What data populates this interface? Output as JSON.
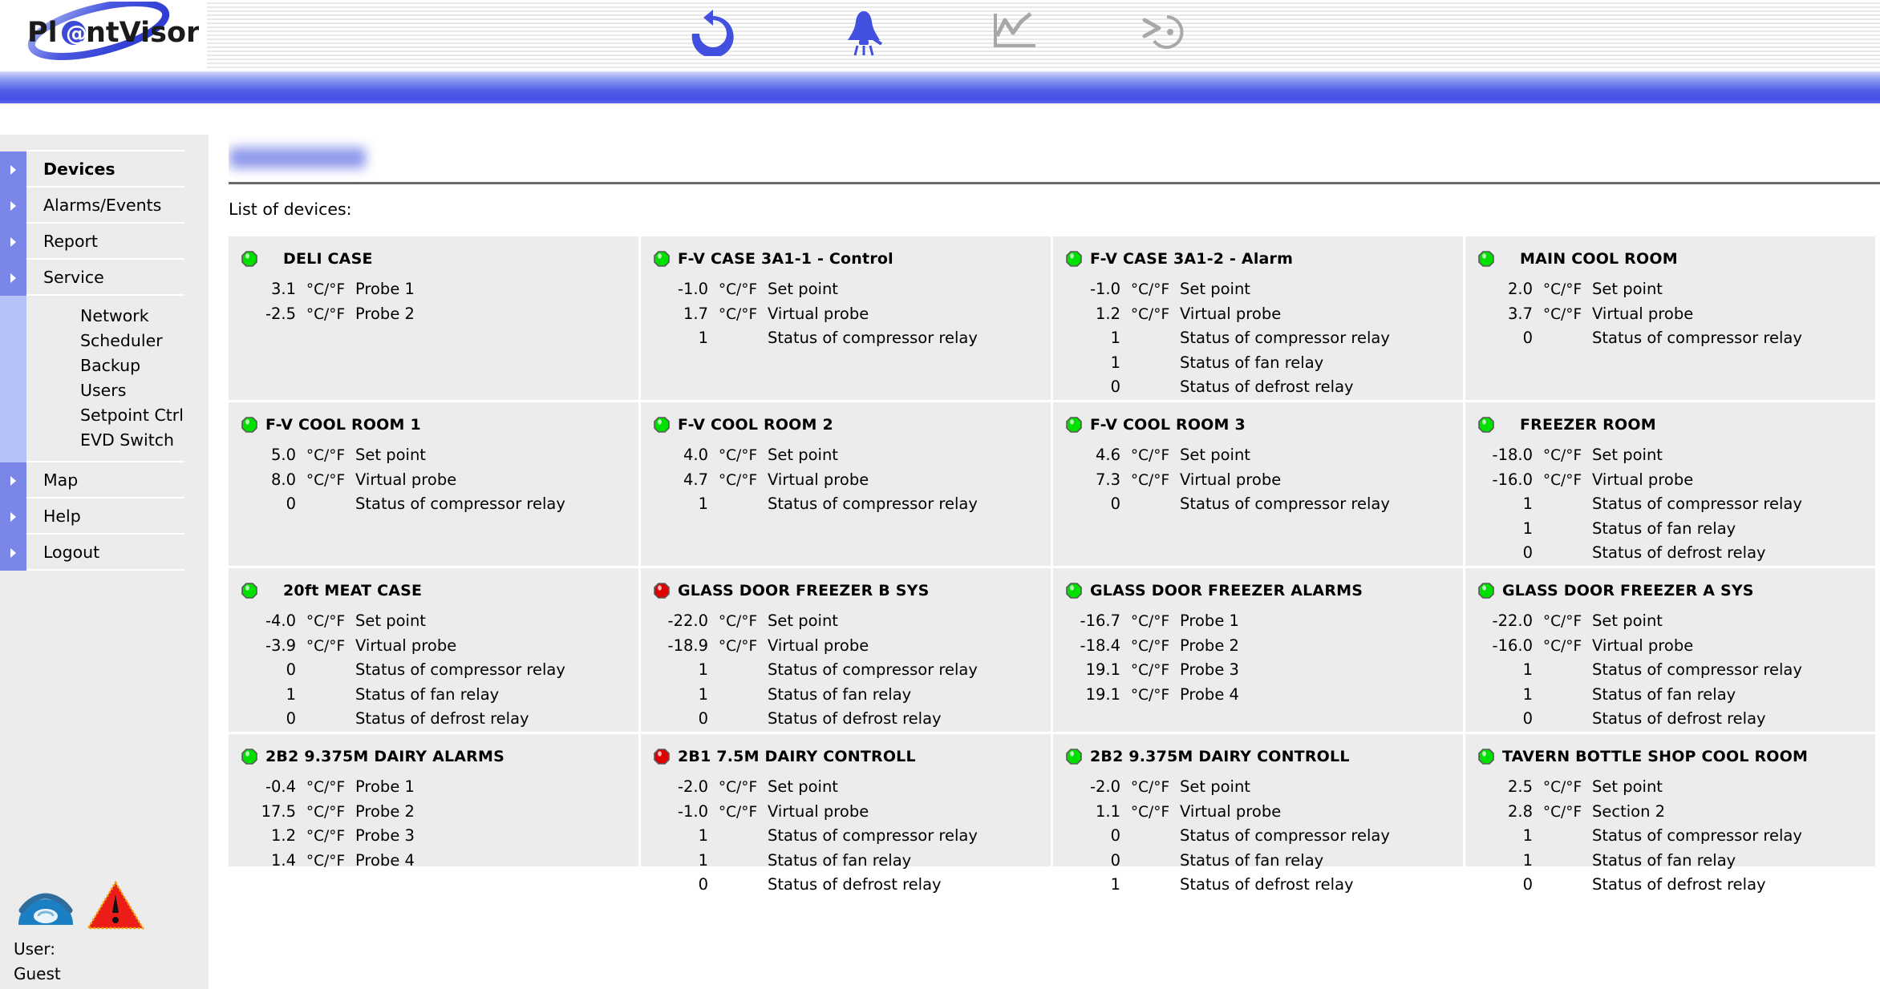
{
  "app": {
    "brand": "Pl@ntVisor",
    "brand_parts": {
      "pre": "Pl",
      "at": "@",
      "post": "ntVisor"
    }
  },
  "toolbar": {
    "items": [
      {
        "name": "refresh-icon",
        "label": "Refresh",
        "color": "#4250e0",
        "active": true
      },
      {
        "name": "alarm-bell-icon",
        "label": "Alarms",
        "color": "#4250e0",
        "active": true
      },
      {
        "name": "chart-icon",
        "label": "Graphs",
        "color": "#a8a8a8",
        "active": false
      },
      {
        "name": "history-icon",
        "label": "History",
        "color": "#a8a8a8",
        "active": false
      }
    ]
  },
  "sidebar": {
    "items": [
      {
        "label": "Devices",
        "active": true
      },
      {
        "label": "Alarms/Events",
        "active": false
      },
      {
        "label": "Report",
        "active": false
      },
      {
        "label": "Service",
        "active": false
      }
    ],
    "subitems": [
      {
        "label": "Network"
      },
      {
        "label": "Scheduler"
      },
      {
        "label": "Backup"
      },
      {
        "label": "Users"
      },
      {
        "label": "Setpoint Ctrl"
      },
      {
        "label": "EVD Switch"
      }
    ],
    "items_bottom": [
      {
        "label": "Map",
        "active": false
      },
      {
        "label": "Help",
        "active": false
      },
      {
        "label": "Logout",
        "active": false
      }
    ],
    "user": {
      "label": "User:",
      "name": "Guest",
      "phone_icon": "telephone-icon",
      "alarm_icon": "warning-triangle-icon"
    }
  },
  "main": {
    "page_title": "",
    "page_title_redacted": true,
    "list_label": "List of devices:"
  },
  "colors": {
    "led_ok": "#00e000",
    "led_alarm": "#e00000",
    "accent_blue": "#4450e6",
    "nav_arrow": "#7b87e8",
    "subnav_bar": "#b5c1f7",
    "card_bg": "#ececec",
    "sidebar_bg": "#ececec"
  },
  "devices": [
    {
      "name": "DELI CASE",
      "status": "ok",
      "indent": true,
      "rows": [
        {
          "value": "3.1",
          "unit": "°C/°F",
          "label": "Probe 1"
        },
        {
          "value": "-2.5",
          "unit": "°C/°F",
          "label": "Probe 2"
        }
      ]
    },
    {
      "name": "F-V CASE 3A1-1 - Control",
      "status": "ok",
      "indent": false,
      "rows": [
        {
          "value": "-1.0",
          "unit": "°C/°F",
          "label": "Set point"
        },
        {
          "value": "1.7",
          "unit": "°C/°F",
          "label": "Virtual probe"
        },
        {
          "value": "1",
          "unit": "",
          "label": "Status of compressor relay"
        }
      ]
    },
    {
      "name": "F-V CASE 3A1-2 - Alarm",
      "status": "ok",
      "indent": false,
      "rows": [
        {
          "value": "-1.0",
          "unit": "°C/°F",
          "label": "Set point"
        },
        {
          "value": "1.2",
          "unit": "°C/°F",
          "label": "Virtual probe"
        },
        {
          "value": "1",
          "unit": "",
          "label": "Status of compressor relay"
        },
        {
          "value": "1",
          "unit": "",
          "label": "Status of fan relay"
        },
        {
          "value": "0",
          "unit": "",
          "label": "Status of defrost relay"
        }
      ]
    },
    {
      "name": "MAIN COOL ROOM",
      "status": "ok",
      "indent": true,
      "rows": [
        {
          "value": "2.0",
          "unit": "°C/°F",
          "label": "Set point"
        },
        {
          "value": "3.7",
          "unit": "°C/°F",
          "label": "Virtual probe"
        },
        {
          "value": "0",
          "unit": "",
          "label": "Status of compressor relay"
        }
      ]
    },
    {
      "name": "F-V COOL ROOM 1",
      "status": "ok",
      "indent": false,
      "rows": [
        {
          "value": "5.0",
          "unit": "°C/°F",
          "label": "Set point"
        },
        {
          "value": "8.0",
          "unit": "°C/°F",
          "label": "Virtual probe"
        },
        {
          "value": "0",
          "unit": "",
          "label": "Status of compressor relay"
        }
      ]
    },
    {
      "name": "F-V COOL ROOM 2",
      "status": "ok",
      "indent": false,
      "rows": [
        {
          "value": "4.0",
          "unit": "°C/°F",
          "label": "Set point"
        },
        {
          "value": "4.7",
          "unit": "°C/°F",
          "label": "Virtual probe"
        },
        {
          "value": "1",
          "unit": "",
          "label": "Status of compressor relay"
        }
      ]
    },
    {
      "name": "F-V COOL ROOM 3",
      "status": "ok",
      "indent": false,
      "rows": [
        {
          "value": "4.6",
          "unit": "°C/°F",
          "label": "Set point"
        },
        {
          "value": "7.3",
          "unit": "°C/°F",
          "label": "Virtual probe"
        },
        {
          "value": "0",
          "unit": "",
          "label": "Status of compressor relay"
        }
      ]
    },
    {
      "name": "FREEZER ROOM",
      "status": "ok",
      "indent": true,
      "rows": [
        {
          "value": "-18.0",
          "unit": "°C/°F",
          "label": "Set point"
        },
        {
          "value": "-16.0",
          "unit": "°C/°F",
          "label": "Virtual probe"
        },
        {
          "value": "1",
          "unit": "",
          "label": "Status of compressor relay"
        },
        {
          "value": "1",
          "unit": "",
          "label": "Status of fan relay"
        },
        {
          "value": "0",
          "unit": "",
          "label": "Status of defrost relay"
        }
      ]
    },
    {
      "name": "20ft MEAT CASE",
      "status": "ok",
      "indent": true,
      "rows": [
        {
          "value": "-4.0",
          "unit": "°C/°F",
          "label": "Set point"
        },
        {
          "value": "-3.9",
          "unit": "°C/°F",
          "label": "Virtual probe"
        },
        {
          "value": "0",
          "unit": "",
          "label": "Status of compressor relay"
        },
        {
          "value": "1",
          "unit": "",
          "label": "Status of fan relay"
        },
        {
          "value": "0",
          "unit": "",
          "label": "Status of defrost relay"
        }
      ]
    },
    {
      "name": "GLASS DOOR FREEZER B SYS",
      "status": "alarm",
      "indent": false,
      "rows": [
        {
          "value": "-22.0",
          "unit": "°C/°F",
          "label": "Set point"
        },
        {
          "value": "-18.9",
          "unit": "°C/°F",
          "label": "Virtual probe"
        },
        {
          "value": "1",
          "unit": "",
          "label": "Status of compressor relay"
        },
        {
          "value": "1",
          "unit": "",
          "label": "Status of fan relay"
        },
        {
          "value": "0",
          "unit": "",
          "label": "Status of defrost relay"
        }
      ]
    },
    {
      "name": "GLASS DOOR FREEZER ALARMS",
      "status": "ok",
      "indent": false,
      "rows": [
        {
          "value": "-16.7",
          "unit": "°C/°F",
          "label": "Probe 1"
        },
        {
          "value": "-18.4",
          "unit": "°C/°F",
          "label": "Probe 2"
        },
        {
          "value": "19.1",
          "unit": "°C/°F",
          "label": "Probe 3"
        },
        {
          "value": "19.1",
          "unit": "°C/°F",
          "label": "Probe 4"
        }
      ]
    },
    {
      "name": "GLASS DOOR FREEZER A SYS",
      "status": "ok",
      "indent": false,
      "rows": [
        {
          "value": "-22.0",
          "unit": "°C/°F",
          "label": "Set point"
        },
        {
          "value": "-16.0",
          "unit": "°C/°F",
          "label": "Virtual probe"
        },
        {
          "value": "1",
          "unit": "",
          "label": "Status of compressor relay"
        },
        {
          "value": "1",
          "unit": "",
          "label": "Status of fan relay"
        },
        {
          "value": "0",
          "unit": "",
          "label": "Status of defrost relay"
        }
      ]
    },
    {
      "name": "2B2 9.375M DAIRY ALARMS",
      "status": "ok",
      "indent": false,
      "rows": [
        {
          "value": "-0.4",
          "unit": "°C/°F",
          "label": "Probe 1"
        },
        {
          "value": "17.5",
          "unit": "°C/°F",
          "label": "Probe 2"
        },
        {
          "value": "1.2",
          "unit": "°C/°F",
          "label": "Probe 3"
        },
        {
          "value": "1.4",
          "unit": "°C/°F",
          "label": "Probe 4"
        }
      ]
    },
    {
      "name": "2B1 7.5M DAIRY CONTROLL",
      "status": "alarm",
      "indent": false,
      "rows": [
        {
          "value": "-2.0",
          "unit": "°C/°F",
          "label": "Set point"
        },
        {
          "value": "-1.0",
          "unit": "°C/°F",
          "label": "Virtual probe"
        },
        {
          "value": "1",
          "unit": "",
          "label": "Status of compressor relay"
        },
        {
          "value": "1",
          "unit": "",
          "label": "Status of fan relay"
        },
        {
          "value": "0",
          "unit": "",
          "label": "Status of defrost relay"
        }
      ]
    },
    {
      "name": "2B2 9.375M DAIRY CONTROLL",
      "status": "ok",
      "indent": false,
      "rows": [
        {
          "value": "-2.0",
          "unit": "°C/°F",
          "label": "Set point"
        },
        {
          "value": "1.1",
          "unit": "°C/°F",
          "label": "Virtual probe"
        },
        {
          "value": "0",
          "unit": "",
          "label": "Status of compressor relay"
        },
        {
          "value": "0",
          "unit": "",
          "label": "Status of fan relay"
        },
        {
          "value": "1",
          "unit": "",
          "label": "Status of defrost relay"
        }
      ]
    },
    {
      "name": "TAVERN BOTTLE SHOP COOL ROOM",
      "status": "ok",
      "indent": false,
      "rows": [
        {
          "value": "2.5",
          "unit": "°C/°F",
          "label": "Set point"
        },
        {
          "value": "2.8",
          "unit": "°C/°F",
          "label": "Section 2"
        },
        {
          "value": "1",
          "unit": "",
          "label": "Status of compressor relay"
        },
        {
          "value": "1",
          "unit": "",
          "label": "Status of fan relay"
        },
        {
          "value": "0",
          "unit": "",
          "label": "Status of defrost relay"
        }
      ]
    }
  ]
}
